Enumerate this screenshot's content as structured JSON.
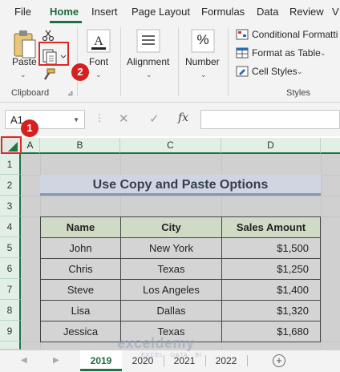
{
  "ribbon_tabs": [
    "File",
    "Home",
    "Insert",
    "Page Layout",
    "Formulas",
    "Data",
    "Review",
    "V"
  ],
  "ribbon": {
    "paste_label": "Paste",
    "clipboard_label": "Clipboard",
    "font_label": "Font",
    "alignment_label": "Alignment",
    "number_label": "Number",
    "number_symbol": "%",
    "styles": {
      "conditional": "Conditional Formatti",
      "format_table": "Format as Table",
      "cell_styles": "Cell Styles",
      "label": "Styles"
    }
  },
  "formula_bar": {
    "name_box": "A1",
    "fx": "fx",
    "cancel": "✕",
    "enter": "✓",
    "value": ""
  },
  "columns": [
    "A",
    "B",
    "C",
    "D"
  ],
  "rows": [
    "1",
    "2",
    "3",
    "4",
    "5",
    "6",
    "7",
    "8",
    "9"
  ],
  "sheet": {
    "title": "Use Copy and Paste Options",
    "headers": [
      "Name",
      "City",
      "Sales Amount"
    ],
    "rows": [
      [
        "John",
        "New York",
        "$1,500"
      ],
      [
        "Chris",
        "Texas",
        "$1,250"
      ],
      [
        "Steve",
        "Los Angeles",
        "$1,400"
      ],
      [
        "Lisa",
        "Dallas",
        "$1,320"
      ],
      [
        "Jessica",
        "Texas",
        "$1,680"
      ]
    ]
  },
  "sheet_tabs": [
    "2019",
    "2020",
    "2021",
    "2022"
  ],
  "active_sheet": "2019",
  "watermark": {
    "main": "exceldemy",
    "sub": "EXCEL · DATA · BI"
  },
  "callouts": [
    "1",
    "2"
  ],
  "colors": {
    "accent": "#217346",
    "callout": "#d61f1f",
    "title_fill": "#cfd6e1",
    "header_fill": "#d0dbc6"
  }
}
